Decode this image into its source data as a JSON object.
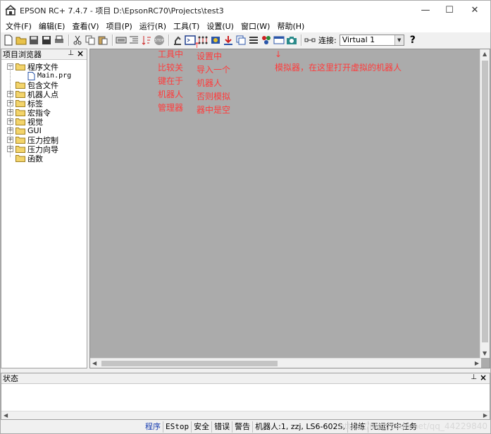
{
  "app": {
    "title": "EPSON RC+ 7.4.7 - 项目 D:\\EpsonRC70\\Projects\\test3"
  },
  "menu": [
    "文件(F)",
    "编辑(E)",
    "查看(V)",
    "项目(P)",
    "运行(R)",
    "工具(T)",
    "设置(U)",
    "窗口(W)",
    "帮助(H)"
  ],
  "toolbar": {
    "connection_label": "连接:",
    "connection_value": "Virtual 1",
    "help_glyph": "?"
  },
  "project_browser": {
    "title": "项目浏览器",
    "items": [
      {
        "label": "程序文件",
        "expander": "−",
        "level": 0
      },
      {
        "label": "Main.prg",
        "level": 1
      },
      {
        "label": "包含文件",
        "level": 0
      },
      {
        "label": "机器人点",
        "expander": "+",
        "level": 0
      },
      {
        "label": "标签",
        "expander": "+",
        "level": 0
      },
      {
        "label": "宏指令",
        "expander": "+",
        "level": 0
      },
      {
        "label": "视觉",
        "expander": "+",
        "level": 0
      },
      {
        "label": "GUI",
        "expander": "+",
        "level": 0
      },
      {
        "label": "压力控制",
        "expander": "+",
        "level": 0
      },
      {
        "label": "压力向导",
        "expander": "+",
        "level": 0
      },
      {
        "label": "函数",
        "level": 0
      }
    ]
  },
  "annotations": {
    "a1": "工具中\n比较关\n键在于\n机器人\n管理器",
    "a2": "设置中\n导入一个\n机器人\n否则模拟\n器中是空",
    "a3": "↓\n模拟器，在这里打开虚拟的机器人",
    "arrow2": "↑"
  },
  "status_panel": {
    "title": "状态"
  },
  "statusbar": {
    "cells": [
      "程序",
      "EStop",
      "安全",
      "错误",
      "警告",
      "机器人:1,  zzj,  LS6-602S,",
      "排练",
      "无运行中任务"
    ]
  },
  "watermark": "https://blog.csdn.net/qq_44229840"
}
